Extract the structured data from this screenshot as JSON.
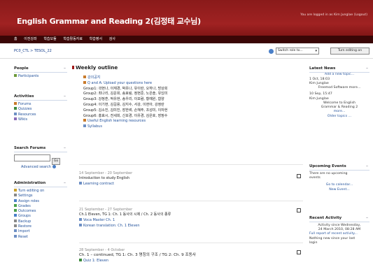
{
  "header": {
    "course_title": "English Grammar and Reading 2(김정태 교수님)",
    "login_info": "You are logged in as Kim Junglae (Logout)",
    "menu": [
      "홈",
      "이전강좌",
      "학습모듈",
      "학습활동자료",
      "학습평서",
      "검사"
    ]
  },
  "crumbbar": {
    "breadcrumb": "PC0_CTL > TESOL_22",
    "switch_role": "Switch role to...",
    "turn_editing": "Turn editing on"
  },
  "left": {
    "people": {
      "title": "People",
      "items": [
        "Participants"
      ]
    },
    "activities": {
      "title": "Activities",
      "items": [
        "Forums",
        "Quizzes",
        "Resources",
        "Wikis"
      ]
    },
    "search": {
      "title": "Search Forums",
      "go": "Go",
      "advanced": "Advanced search"
    },
    "admin": {
      "title": "Administration",
      "items": [
        "Turn editing on",
        "Settings",
        "Assign roles",
        "Grades",
        "Outcomes",
        "Groups",
        "Backup",
        "Restore",
        "Import",
        "Reset"
      ]
    }
  },
  "main": {
    "title": "Weekly outline",
    "intro": {
      "links": [
        "강의공지",
        "Q and A: Upload your questions here"
      ],
      "groups": [
        "Group1: 곽현나, 이재경, 박유나, 유이란, 오하나, 방상희",
        "Group2: 최나리, 김운희, 송효림, 정현준, 노은솔, 유있미",
        "Group3: 강정훈, 박유현, 송우리, 이보람, 황예원, 함양",
        "Group4: 이기현, 김길용, 김지수, 서강, 이현아, 강정란",
        "Group5: 김소진, 김미진, 장한벼, 손혜주, 조성미, 이자현",
        "Group6: 홍효시, 전세희, 신보경, 이유경, 김은호, 장정수"
      ],
      "links2": [
        "Useful English learning resources",
        "Syllabus"
      ]
    },
    "weeks": [
      {
        "date": "14 September - 20 September",
        "lines": [
          "Introduction to study English"
        ],
        "links": [
          "Learning contract"
        ]
      },
      {
        "date": "21 September - 27 September",
        "lines": [
          "Ch.1 Eleven, TG 1: Ch. 1 동사의 시제 / Ch. 2 동사의 종류"
        ],
        "links": [
          "Voca Master Ch. 1",
          "Korean translation: Ch. 1 Eleven"
        ]
      },
      {
        "date": "28 September - 4 October",
        "lines": [
          "Ch. 1 – continued, TG 1: Ch. 3 명칭의 구조 / TG 2: Ch. 9 조동사"
        ],
        "links": [
          "Quiz 1: Eleven"
        ]
      }
    ]
  },
  "right": {
    "news": {
      "title": "Latest News",
      "add": "Add a new topic...",
      "item1": [
        "1 Oct, 18:03",
        "Kim Junglae",
        "Freemod Software more..."
      ],
      "item2": [
        "10 Sep, 15:47",
        "Kim Junglae",
        "Welcome to English",
        "Grammar & Reading 2",
        "more...",
        "Older topics ..."
      ]
    },
    "events": {
      "title": "Upcoming Events",
      "text": [
        "There are no upcoming",
        "events"
      ],
      "links": [
        "Go to calendar...",
        "New Event..."
      ]
    },
    "activity": {
      "title": "Recent Activity",
      "text": [
        "Activity since Wednesday,",
        "24 March 2010, 08:28 AM"
      ],
      "link": "Full report of recent activity...",
      "note": [
        "Nothing new since your last",
        "login"
      ]
    }
  }
}
